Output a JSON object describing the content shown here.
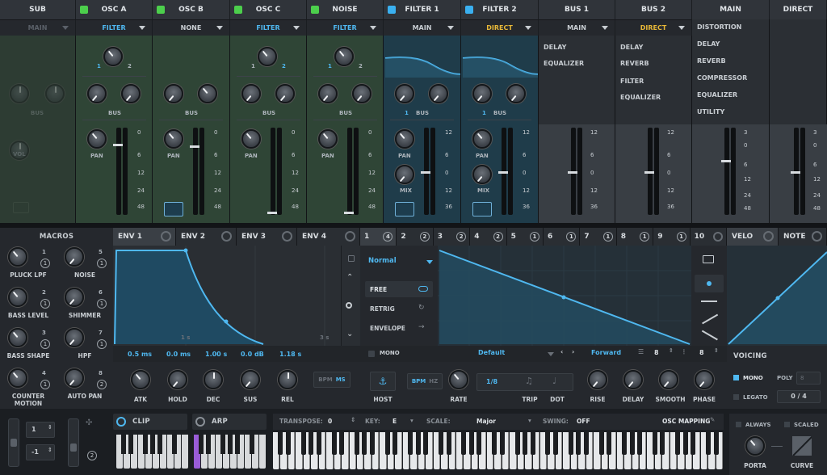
{
  "osc_headers": [
    {
      "label": "SUB",
      "led": false
    },
    {
      "label": "OSC A",
      "led": true
    },
    {
      "label": "OSC B",
      "led": true
    },
    {
      "label": "OSC C",
      "led": true
    },
    {
      "label": "NOISE",
      "led": true
    },
    {
      "label": "FILTER 1",
      "led": true,
      "led_color": "#3ab0f0"
    },
    {
      "label": "FILTER 2",
      "led": true,
      "led_color": "#3ab0f0"
    },
    {
      "label": "BUS 1"
    },
    {
      "label": "BUS 2"
    },
    {
      "label": "MAIN"
    },
    {
      "label": "DIRECT"
    }
  ],
  "routing": [
    "MAIN",
    "FILTER",
    "NONE",
    "FILTER",
    "FILTER",
    "MAIN",
    "DIRECT",
    "MAIN",
    "DIRECT"
  ],
  "osc_labels": {
    "one": "1",
    "two": "2",
    "bus": "BUS",
    "pan": "PAN",
    "mix": "MIX",
    "sub_bus": "BUS",
    "sub_vol": "VOL"
  },
  "meter_scale_osc": [
    "0",
    "6",
    "12",
    "24",
    "48"
  ],
  "meter_scale_filter": [
    "12",
    "6",
    "0",
    "12",
    "36"
  ],
  "meter_scale_main": [
    "3",
    "0",
    "6",
    "12",
    "24",
    "48"
  ],
  "bus1_fx": [
    "DELAY",
    "EQUALIZER"
  ],
  "bus2_fx": [
    "DELAY",
    "REVERB",
    "FILTER",
    "EQUALIZER"
  ],
  "main_fx": [
    "DISTORTION",
    "DELAY",
    "REVERB",
    "COMPRESSOR",
    "EQUALIZER",
    "UTILITY"
  ],
  "macros": {
    "title": "MACROS",
    "items": [
      {
        "label": "PLUCK LPF",
        "num": "1"
      },
      {
        "label": "NOISE",
        "num": "5"
      },
      {
        "label": "BASS LEVEL",
        "num": "2"
      },
      {
        "label": "SHIMMER",
        "num": "6"
      },
      {
        "label": "BASS SHAPE",
        "num": "3"
      },
      {
        "label": "HPF",
        "num": "7"
      },
      {
        "label": "COUNTER MOTION",
        "num": "4"
      },
      {
        "label": "AUTO PAN",
        "num": "8"
      }
    ],
    "badges": [
      "1",
      "1",
      "1",
      "1",
      "1",
      "1",
      "1",
      "2"
    ]
  },
  "env_tabs": [
    "ENV 1",
    "ENV 2",
    "ENV 3",
    "ENV 4"
  ],
  "env": {
    "values": [
      "0.5 ms",
      "0.0 ms",
      "1.00 s",
      "0.0 dB",
      "1.18 s"
    ],
    "knobs": [
      "ATK",
      "HOLD",
      "DEC",
      "SUS",
      "REL"
    ],
    "bpm": "BPM",
    "ms": "MS",
    "time1": "1 s",
    "time3": "3 s"
  },
  "lfo_tabs": [
    {
      "n": "1",
      "c": "4"
    },
    {
      "n": "2",
      "c": "2"
    },
    {
      "n": "3",
      "c": "2"
    },
    {
      "n": "4",
      "c": "2"
    },
    {
      "n": "5",
      "c": "1"
    },
    {
      "n": "6",
      "c": "1"
    },
    {
      "n": "7",
      "c": "1"
    },
    {
      "n": "8",
      "c": "1"
    },
    {
      "n": "9",
      "c": "1"
    },
    {
      "n": "10",
      "c": ""
    }
  ],
  "lfo": {
    "mode": "Normal",
    "options": [
      "FREE",
      "RETRIG",
      "ENVELOPE"
    ],
    "mono": "MONO",
    "preset": "Default",
    "direction": "Forward",
    "grid_x": "8",
    "grid_y": "8",
    "host": "HOST",
    "bpm": "BPM",
    "hz": "HZ",
    "rate_value": "1/8",
    "knobs": [
      "RATE",
      "TRIP",
      "DOT",
      "RISE",
      "DELAY",
      "SMOOTH",
      "PHASE"
    ]
  },
  "velo": {
    "tab": "VELO",
    "note": "NOTE"
  },
  "voicing": {
    "title": "VOICING",
    "mono": "MONO",
    "poly": "POLY",
    "poly_value": "8",
    "legato": "LEGATO",
    "count": "0 / 4"
  },
  "bottom": {
    "oct_up": "1",
    "oct_down": "-1",
    "badge": "2",
    "clip": "CLIP",
    "arp": "ARP",
    "transpose_label": "TRANSPOSE:",
    "transpose": "0",
    "key_label": "KEY:",
    "key": "E",
    "scale_label": "SCALE:",
    "scale": "Major",
    "swing_label": "SWING:",
    "swing": "OFF",
    "osc_mapping": "OSC MAPPING",
    "always": "ALWAYS",
    "scaled": "SCALED",
    "porta": "PORTA",
    "curve": "CURVE"
  },
  "colors": {
    "accent": "#3aa8e8",
    "green_panel": "#2f4536",
    "teal_panel": "#1f3c4a",
    "yellow": "#e8b838"
  }
}
